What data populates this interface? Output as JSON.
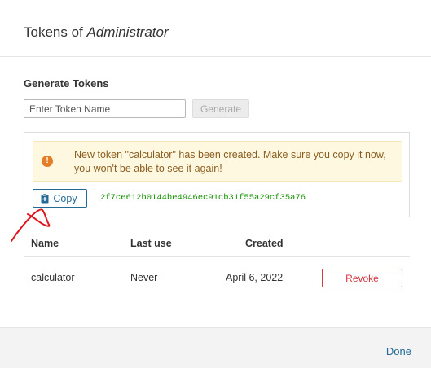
{
  "header": {
    "title_prefix": "Tokens of",
    "user": "Administrator"
  },
  "generate": {
    "heading": "Generate Tokens",
    "input_placeholder": "Enter Token Name",
    "input_value": "",
    "button_label": "Generate"
  },
  "result": {
    "warning_text": "New token \"calculator\" has been created. Make sure you copy it now, you won't be able to see it again!",
    "warning_icon": "exclamation-icon",
    "copy_label": "Copy",
    "token": "2f7ce612b0144be4946ec91cb31f55a29cf35a76"
  },
  "table": {
    "headers": {
      "name": "Name",
      "last_use": "Last use",
      "created": "Created"
    },
    "rows": [
      {
        "name": "calculator",
        "last_use": "Never",
        "created": "April 6, 2022",
        "action": "Revoke"
      }
    ]
  },
  "footer": {
    "done_label": "Done"
  },
  "colors": {
    "link_blue": "#236a97",
    "danger_red": "#d4373f",
    "token_green": "#149200",
    "warning_bg": "#fff8e1",
    "warning_icon": "#e47e26"
  }
}
